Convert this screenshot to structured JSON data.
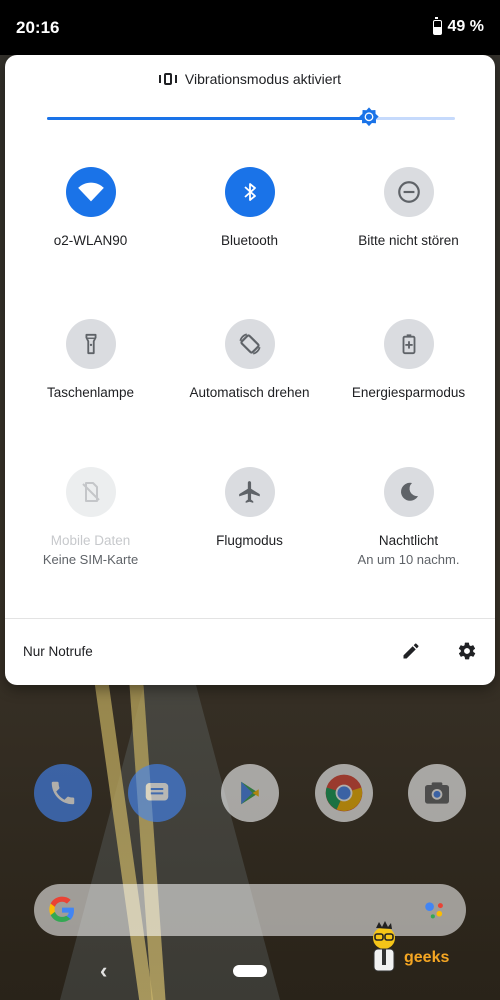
{
  "status_bar": {
    "time": "20:16",
    "battery": "49 %"
  },
  "quick_settings": {
    "vibration_label": "Vibrationsmodus aktiviert",
    "brightness_level": 0.79,
    "accent_color": "#1a73e8",
    "tiles": [
      {
        "label": "o2-WLAN90",
        "icon": "wifi-icon",
        "state": "on"
      },
      {
        "label": "Bluetooth",
        "icon": "bluetooth-icon",
        "state": "on"
      },
      {
        "label": "Bitte nicht stören",
        "icon": "do-not-disturb-icon",
        "state": "off"
      },
      {
        "label": "Taschenlampe",
        "icon": "flashlight-icon",
        "state": "off"
      },
      {
        "label": "Automatisch drehen",
        "icon": "auto-rotate-icon",
        "state": "off"
      },
      {
        "label": "Energiesparmodus",
        "icon": "battery-saver-icon",
        "state": "off"
      },
      {
        "label": "Mobile Daten",
        "sublabel": "Keine SIM-Karte",
        "icon": "mobile-data-off-icon",
        "state": "disabled"
      },
      {
        "label": "Flugmodus",
        "icon": "airplane-icon",
        "state": "off"
      },
      {
        "label": "Nachtlicht",
        "sublabel": "An um 10 nachm.",
        "icon": "night-light-icon",
        "state": "off"
      }
    ],
    "footer_text": "Nur Notrufe"
  },
  "watermark_text": "geeks"
}
